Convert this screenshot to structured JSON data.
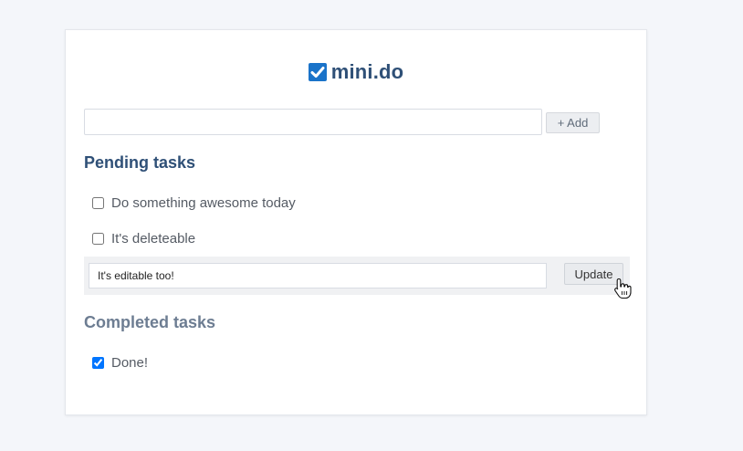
{
  "app": {
    "title": "mini.do",
    "accent_color": "#1a73c9",
    "title_color": "#2f5077"
  },
  "new_task": {
    "value": "",
    "placeholder": "",
    "add_label": "+ Add"
  },
  "pending": {
    "heading": "Pending tasks",
    "tasks": [
      {
        "label": "Do something awesome today",
        "checked": false
      },
      {
        "label": "It's deleteable",
        "checked": false
      }
    ],
    "editing": {
      "value": "It's editable too!",
      "update_label": "Update"
    }
  },
  "completed": {
    "heading": "Completed tasks",
    "tasks": [
      {
        "label": "Done!",
        "checked": true
      }
    ]
  },
  "cursor": {
    "icon": "hand-pointer-icon"
  }
}
